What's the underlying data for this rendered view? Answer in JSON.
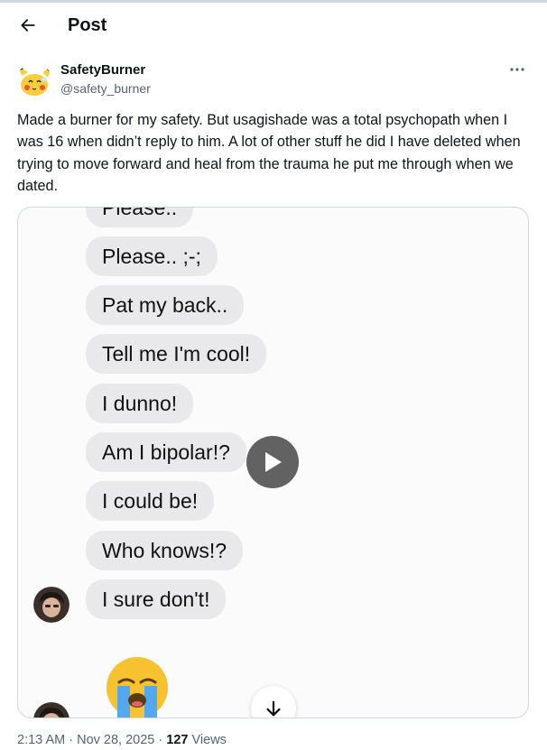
{
  "header": {
    "title": "Post",
    "back_icon": "arrow-left-icon"
  },
  "author": {
    "display_name": "SafetyBurner",
    "handle": "@safety_burner",
    "more_icon": "more-horizontal-icon"
  },
  "tweet": {
    "text": "Made a burner for my safety. But usagishade was a total psychopath when I was 16 when didn’t reply to him. A lot of other stuff he did I have deleted when trying to move forward and heal from the trauma he put me through when we dated."
  },
  "media": {
    "type": "video",
    "play_icon": "play-icon",
    "messages": [
      "Please..",
      "Please.. ;-;",
      "Pat my back..",
      "Tell me I'm cool!",
      "I dunno!",
      "Am I bipolar!?",
      "I could be!",
      "Who knows!?",
      "I sure don't!"
    ],
    "scroll_icon": "arrow-down-icon",
    "emoji": "😭"
  },
  "meta": {
    "time": "2:13 AM",
    "separator": "·",
    "date": "Nov 28, 2025",
    "views_count": "127",
    "views_label": "Views"
  },
  "colors": {
    "text": "#0f1419",
    "secondary": "#536471",
    "border": "#cfd9de",
    "bubble": "#e9e9eb"
  }
}
